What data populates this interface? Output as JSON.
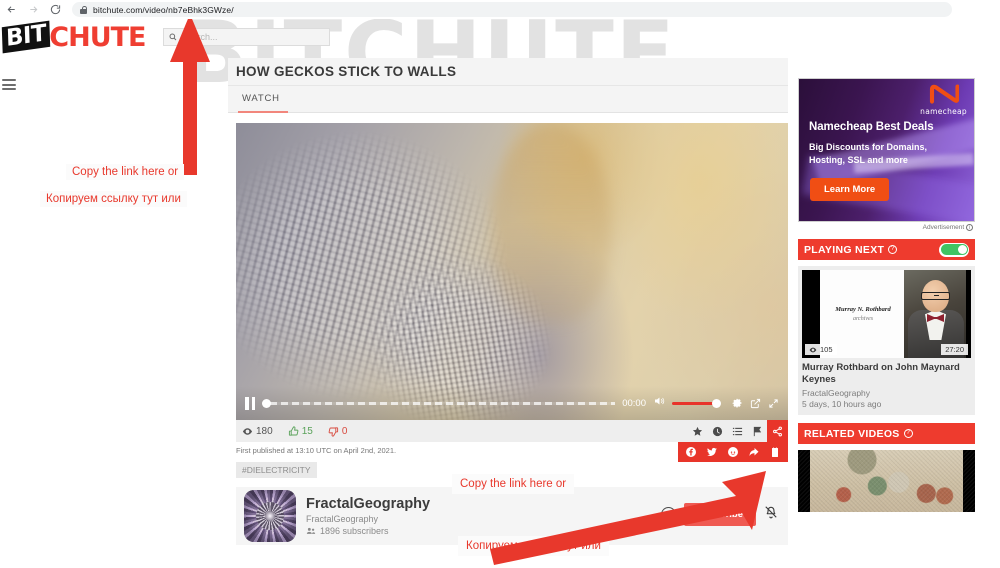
{
  "browser": {
    "back_icon": "back-arrow-icon",
    "forward_icon": "forward-arrow-icon",
    "reload_icon": "reload-icon",
    "url": "bitchute.com/video/nb7eBhk3GWze/"
  },
  "header": {
    "logo_bit": "BIT",
    "logo_chute": "CHUTE",
    "search_placeholder": "Search...",
    "watermark": "BITCHUTE"
  },
  "video": {
    "title": "HOW GECKOS STICK TO WALLS",
    "tab": "WATCH",
    "time": "00:00",
    "views": "180",
    "likes": "15",
    "dislikes": "0",
    "published": "First published at 13:10 UTC on April 2nd, 2021.",
    "tag": "#DIELECTRICITY"
  },
  "share": {
    "facebook": "facebook-icon",
    "twitter": "twitter-icon",
    "reddit": "reddit-icon",
    "share": "share-arrow-icon",
    "copy": "copy-clipboard-icon"
  },
  "channel": {
    "name": "FractalGeography",
    "handle": "FractalGeography",
    "subscribers": "1896 subscribers",
    "tip_label": "$",
    "subscribe_label": "Subscribe",
    "notify_icon": "bell-off-icon"
  },
  "ad": {
    "brand": "namecheap",
    "headline": "Namecheap Best Deals",
    "subhead": "Big Discounts for Domains, Hosting, SSL and more",
    "cta": "Learn More",
    "label": "Advertisement"
  },
  "playing_next": {
    "section_title": "PLAYING NEXT",
    "thumb_name": "Murray N. Rothbard",
    "thumb_sub": "archives",
    "views": "105",
    "duration": "27:20",
    "title": "Murray Rothbard on John Maynard Keynes",
    "channel": "FractalGeography",
    "age": "5 days, 10 hours ago"
  },
  "related": {
    "section_title": "RELATED VIDEOS"
  },
  "annotations": {
    "top_en": "Copy the link here or",
    "top_ru": "Копируем ссылку тут или",
    "bottom_en": "Copy the link here or",
    "bottom_ru": "Копируем ссылку тут или",
    "accent": "#e8382c"
  }
}
